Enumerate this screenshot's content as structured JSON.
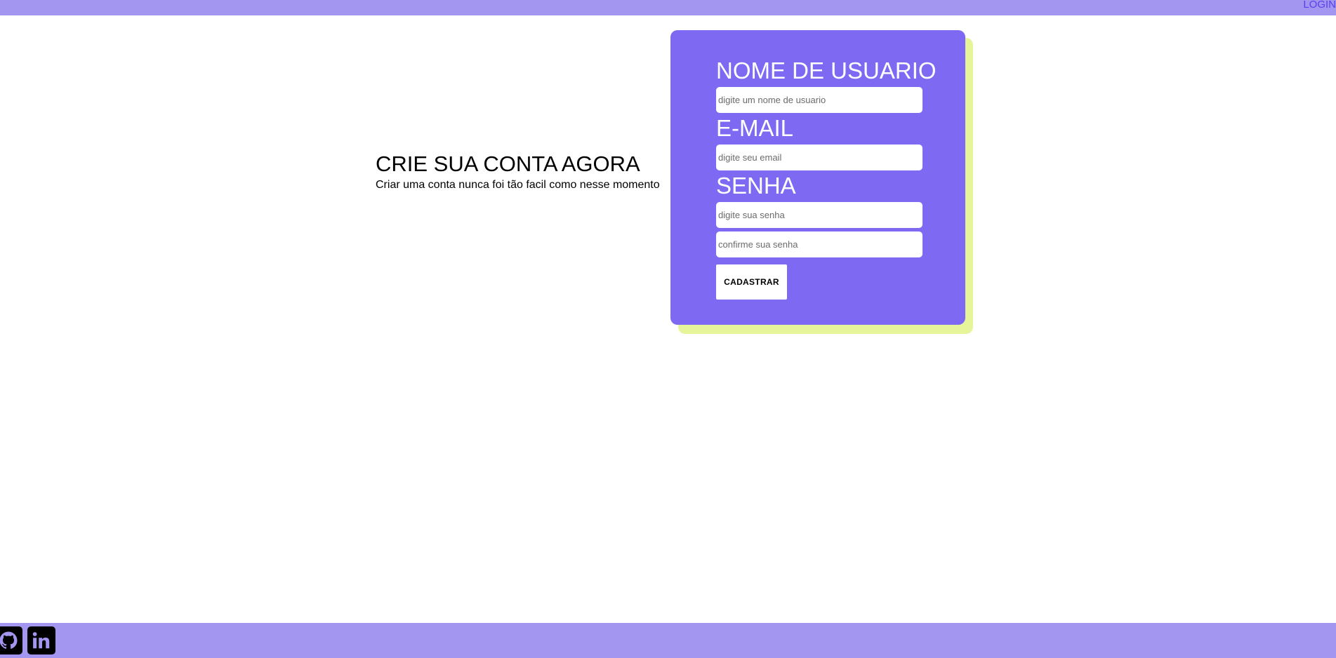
{
  "header": {
    "login_label": "LOGIN"
  },
  "intro": {
    "title": "CRIE SUA CONTA AGORA",
    "subtitle": "Criar uma conta nunca foi tão facil como nesse momento"
  },
  "form": {
    "username_label": "NOME DE USUARIO",
    "username_placeholder": "digite um nome de usuario",
    "email_label": "E-MAIL",
    "email_placeholder": "digite seu email",
    "password_label": "SENHA",
    "password_placeholder": "digite sua senha",
    "confirm_placeholder": "confirme sua senha",
    "submit_label": "CADASTRAR"
  },
  "footer": {
    "icons": [
      "github-icon",
      "linkedin-icon"
    ]
  },
  "colors": {
    "bar": "#a396f0",
    "card": "#7e69f3",
    "card_shadow": "#e6f59a",
    "link": "#5a3ff0"
  }
}
